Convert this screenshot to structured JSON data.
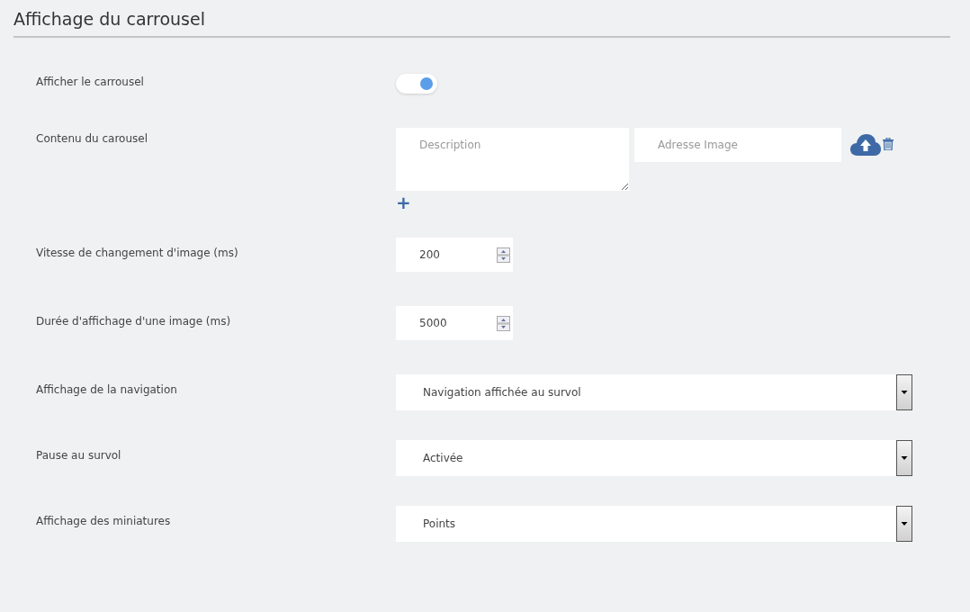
{
  "title": "Affichage du carrousel",
  "rows": [
    {
      "kind": "toggle",
      "label": "Afficher le carrousel",
      "on": true
    },
    {
      "kind": "content",
      "label": "Contenu du carousel",
      "description_placeholder": "Description",
      "address_placeholder": "Adresse Image",
      "add_symbol": "+"
    },
    {
      "kind": "number",
      "label": "Vitesse de changement d'image (ms)",
      "value": "200"
    },
    {
      "kind": "number",
      "label": "Durée d'affichage d'une image (ms)",
      "value": "5000"
    },
    {
      "kind": "select",
      "label": "Affichage de la navigation",
      "value": "Navigation affichée au survol"
    },
    {
      "kind": "select",
      "label": "Pause au survol",
      "value": "Activée"
    },
    {
      "kind": "select",
      "label": "Affichage des miniatures",
      "value": "Points"
    }
  ]
}
